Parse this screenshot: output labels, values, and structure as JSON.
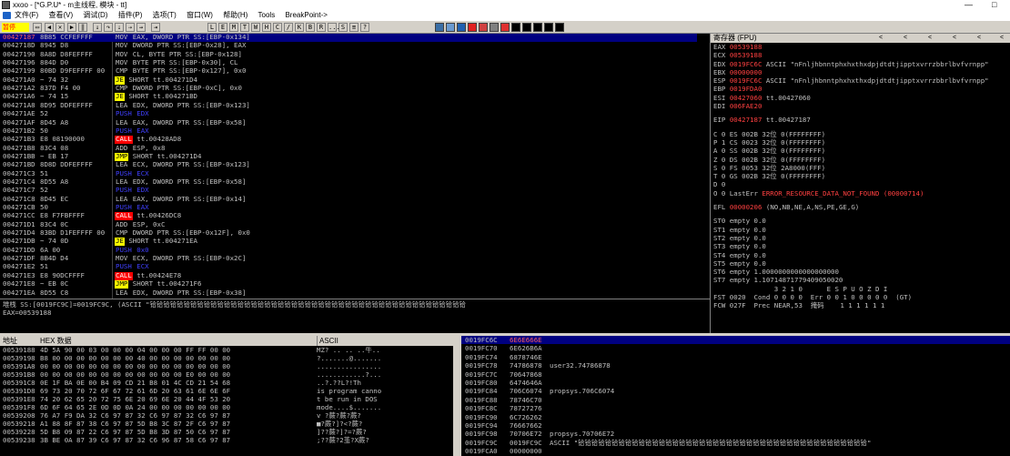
{
  "title": "xxoo - [*G.P.U* - m主线程, 模块 - tt]",
  "window_controls": [
    "—",
    "□"
  ],
  "menu": [
    "文件(F)",
    "查看(V)",
    "调试(D)",
    "插件(P)",
    "选项(T)",
    "窗口(W)",
    "帮助(H)",
    "Tools",
    "BreakPoint->"
  ],
  "status": "暂停",
  "toolbar_letters": [
    "L",
    "E",
    "M",
    "T",
    "W",
    "H",
    "C",
    "/",
    "K",
    "B",
    "R",
    "...",
    "S",
    "≡",
    "?"
  ],
  "disasm": [
    {
      "addr": "00427187",
      "hex": "8B85 CCFEFFFF",
      "asm": "MOV EAX, DWORD PTR SS:[EBP-0x134]",
      "kind": "mov",
      "comment": ""
    },
    {
      "addr": "0042718D",
      "hex": "8945 D8",
      "asm": "MOV DWORD PTR SS:[EBP-0x28], EAX",
      "kind": "mov",
      "comment": ""
    },
    {
      "addr": "00427190",
      "hex": "8A8D D8FEFFFF",
      "asm": "MOV CL, BYTE PTR SS:[EBP-0x128]",
      "kind": "mov",
      "comment": ""
    },
    {
      "addr": "00427196",
      "hex": "884D D0",
      "asm": "MOV BYTE PTR SS:[EBP-0x30], CL",
      "kind": "mov",
      "comment": ""
    },
    {
      "addr": "00427199",
      "hex": "80BD D9FEFFFF 00",
      "asm": "CMP BYTE PTR SS:[EBP-0x127], 0x0",
      "kind": "cmp",
      "comment": ""
    },
    {
      "addr": "004271A0",
      "hex": "~ 74 32",
      "asm": "JE SHORT tt.004271D4",
      "kind": "cond",
      "comment": ""
    },
    {
      "addr": "004271A2",
      "hex": "837D F4 00",
      "asm": "CMP DWORD PTR SS:[EBP-0xC], 0x0",
      "kind": "cmp",
      "comment": ""
    },
    {
      "addr": "004271A6",
      "hex": "~ 74 15",
      "asm": "JE SHORT tt.004271BD",
      "kind": "cond",
      "comment": ""
    },
    {
      "addr": "004271A8",
      "hex": "8D95 DDFEFFFF",
      "asm": "LEA EDX, DWORD PTR SS:[EBP-0x123]",
      "kind": "lea",
      "comment": ""
    },
    {
      "addr": "004271AE",
      "hex": "52",
      "asm": "PUSH EDX",
      "kind": "stack",
      "comment": ""
    },
    {
      "addr": "004271AF",
      "hex": "8D45 A8",
      "asm": "LEA EAX, DWORD PTR SS:[EBP-0x58]",
      "kind": "lea",
      "comment": ""
    },
    {
      "addr": "004271B2",
      "hex": "50",
      "asm": "PUSH EAX",
      "kind": "stack",
      "comment": ""
    },
    {
      "addr": "004271B3",
      "hex": "E8 08190000",
      "asm": "CALL tt.00428AD8",
      "kind": "call",
      "comment": ""
    },
    {
      "addr": "004271B8",
      "hex": "83C4 08",
      "asm": "ADD ESP, 0x8",
      "kind": "mov",
      "comment": ""
    },
    {
      "addr": "004271BB",
      "hex": "~ EB 17",
      "asm": "JMP SHORT tt.004271D4",
      "kind": "jmp",
      "comment": ""
    },
    {
      "addr": "004271BD",
      "hex": "8D8D DDFEFFFF",
      "asm": "LEA ECX, DWORD PTR SS:[EBP-0x123]",
      "kind": "lea",
      "comment": ""
    },
    {
      "addr": "004271C3",
      "hex": "51",
      "asm": "PUSH ECX",
      "kind": "stack",
      "comment": ""
    },
    {
      "addr": "004271C4",
      "hex": "8D55 A8",
      "asm": "LEA EDX, DWORD PTR SS:[EBP-0x58]",
      "kind": "lea",
      "comment": ""
    },
    {
      "addr": "004271C7",
      "hex": "52",
      "asm": "PUSH EDX",
      "kind": "stack",
      "comment": ""
    },
    {
      "addr": "004271C8",
      "hex": "8D45 EC",
      "asm": "LEA EAX, DWORD PTR SS:[EBP-0x14]",
      "kind": "lea",
      "comment": ""
    },
    {
      "addr": "004271CB",
      "hex": "50",
      "asm": "PUSH EAX",
      "kind": "stack",
      "comment": ""
    },
    {
      "addr": "004271CC",
      "hex": "E8 F7FBFFFF",
      "asm": "CALL tt.00426DC8",
      "kind": "call",
      "comment": ""
    },
    {
      "addr": "004271D1",
      "hex": "83C4 0C",
      "asm": "ADD ESP, 0xC",
      "kind": "mov",
      "comment": ""
    },
    {
      "addr": "004271D4",
      "hex": "83BD D1FEFFFF 00",
      "asm": "CMP DWORD PTR SS:[EBP-0x12F], 0x0",
      "kind": "cmp",
      "comment": ""
    },
    {
      "addr": "004271DB",
      "hex": "~ 74 0D",
      "asm": "JE SHORT tt.004271EA",
      "kind": "cond",
      "comment": ""
    },
    {
      "addr": "004271DD",
      "hex": "6A 00",
      "asm": "PUSH 0x0",
      "kind": "stack",
      "comment": ""
    },
    {
      "addr": "004271DF",
      "hex": "8B4D D4",
      "asm": "MOV ECX, DWORD PTR SS:[EBP-0x2C]",
      "kind": "mov",
      "comment": ""
    },
    {
      "addr": "004271E2",
      "hex": "51",
      "asm": "PUSH ECX",
      "kind": "stack",
      "comment": ""
    },
    {
      "addr": "004271E3",
      "hex": "E8 90DCFFFF",
      "asm": "CALL tt.00424E78",
      "kind": "call",
      "comment": ""
    },
    {
      "addr": "004271E8",
      "hex": "~ EB 0C",
      "asm": "JMP SHORT tt.004271F6",
      "kind": "jmp",
      "comment": ""
    },
    {
      "addr": "004271EA",
      "hex": "8D55 C8",
      "asm": "LEA EDX, DWORD PTR SS:[EBP-0x38]",
      "kind": "lea",
      "comment": ""
    }
  ],
  "info_lines": [
    "堆栈 SS:[0019FC9C]=0019FC9C, (ASCII \"铪铪铪铪铪铪铪铪铪铪铪铪铪铪铪铪铪铪铪铪铪铪铪铪铪铪铪铪铪铪铪铪铪铪铪铪铪铪铪铪铪铪铪铪铪铪铪",
    "EAX=00539188"
  ],
  "registers": {
    "header": "寄存器 (FPU)",
    "lines": [
      {
        "name": "EAX",
        "val": "00539188",
        "extra": "",
        "red": true
      },
      {
        "name": "ECX",
        "val": "00539188",
        "extra": "",
        "red": true
      },
      {
        "name": "EDX",
        "val": "0019FC6C",
        "extra": "ASCII \"nFnljhbnntphxhxthxdpjdtdtjipptxvrrzbbrlbvfvrnpp\"",
        "red": true
      },
      {
        "name": "EBX",
        "val": "00000000",
        "extra": "",
        "red": true
      },
      {
        "name": "ESP",
        "val": "0019FC6C",
        "extra": "ASCII \"nFnljhbnntphxhxthxdpjdtdtjipptxvrrzbbrlbvfvrnpp\"",
        "red": true
      },
      {
        "name": "EBP",
        "val": "0019FDA0",
        "extra": "",
        "red": true
      },
      {
        "name": "ESI",
        "val": "00427060",
        "extra": "tt.00427060",
        "red": true
      },
      {
        "name": "EDI",
        "val": "006FAE20",
        "extra": "",
        "red": true
      }
    ],
    "eip": {
      "name": "EIP",
      "val": "00427187",
      "extra": "tt.00427187"
    },
    "segs": [
      "C 0  ES 002B 32位 0(FFFFFFFF)",
      "P 1  CS 0023 32位 0(FFFFFFFF)",
      "A 0  SS 002B 32位 0(FFFFFFFF)",
      "Z 0  DS 002B 32位 0(FFFFFFFF)",
      "S 0  FS 0053 32位 2A8000(FFF)",
      "T 0  GS 002B 32位 0(FFFFFFFF)",
      "D 0"
    ],
    "lasterr_prefix": "O 0  LastErr",
    "lasterr": "ERROR_RESOURCE_DATA_NOT_FOUND (00000714)",
    "efl_label": "EFL",
    "efl_val": "00000206",
    "efl_extra": "(NO,NB,NE,A,NS,PE,GE,G)",
    "fpu": [
      "ST0 empty 0.0",
      "ST1 empty 0.0",
      "ST2 empty 0.0",
      "ST3 empty 0.0",
      "ST4 empty 0.0",
      "ST5 empty 0.0",
      "ST6 empty 1.0000000000000000000",
      "ST7 empty 1.10714871779409050020",
      "               3 2 1 0      E S P U O Z D I",
      "FST 0020  Cond 0 0 0 0  Err 0 0 1 0 0 0 0 0  (GT)",
      "FCW 027F  Prec NEAR,53  掩码    1 1 1 1 1 1"
    ]
  },
  "dump": {
    "col_addr": "地址",
    "col_hex": "HEX 数据",
    "col_ascii": "ASCII",
    "rows": [
      {
        "a": "00539188",
        "h": "4D 5A 90 00 03 00 00 00 04 00 00 00 FF FF 00 00",
        "t": "MZ?  .. ..  ..牛.."
      },
      {
        "a": "00539198",
        "h": "B8 00 00 00 00 00 00 00 40 00 00 00 00 00 00 00",
        "t": "?.......@......."
      },
      {
        "a": "005391A8",
        "h": "00 00 00 00 00 00 00 00 00 00 00 00 00 00 00 00",
        "t": "................"
      },
      {
        "a": "005391B8",
        "h": "00 00 00 00 00 00 00 00 00 00 00 00 E0 00 00 00",
        "t": "............?..."
      },
      {
        "a": "005391C8",
        "h": "0E 1F BA 0E 00 B4 09 CD 21 B8 01 4C CD 21 54 68",
        "t": "..?.??L?!Th"
      },
      {
        "a": "005391D8",
        "h": "69 73 20 70 72 6F 67 72 61 6D 20 63 61 6E 6E 6F",
        "t": "is program canno"
      },
      {
        "a": "005391E8",
        "h": "74 20 62 65 20 72 75 6E 20 69 6E 20 44 4F 53 20",
        "t": "t be run in DOS "
      },
      {
        "a": "005391F8",
        "h": "6D 6F 64 65 2E 0D 0D 0A 24 00 00 00 00 00 00 00",
        "t": "mode....$......."
      },
      {
        "a": "00539208",
        "h": "76 A7 F9 DA 32 C6 97 87 32 C6 97 87 32 C6 97 87",
        "t": "v  ?蕨?蕨?蕨?"
      },
      {
        "a": "00539218",
        "h": "A1 88 8F 87 38 C6 97 87 5D B8 3C 87 2F C6 97 87",
        "t": "  ■?蕨?]?<?蕨?"
      },
      {
        "a": "00539228",
        "h": "5D B8 09 87 22 C6 97 87 5D B8 3D 87 50 C6 97 87",
        "t": "]??蕨?]?=?蕨?"
      },
      {
        "a": "00539238",
        "h": "3B BE 0A 87 39 C6 97 87 32 C6 96 87 58 C6 97 87",
        "t": ";??蕨?2茧?X蕨?"
      }
    ]
  },
  "stack": {
    "rows": [
      {
        "a": "0019FC6C",
        "v": "6E6E666E",
        "c": "",
        "sel": true
      },
      {
        "a": "0019FC70",
        "v": "6E626B6A",
        "c": "",
        "sel": false
      },
      {
        "a": "0019FC74",
        "v": "6878746E",
        "c": "",
        "sel": false
      },
      {
        "a": "0019FC78",
        "v": "74786878",
        "c": "user32.74786878",
        "sel": false
      },
      {
        "a": "0019FC7C",
        "v": "70647868",
        "c": "",
        "sel": false
      },
      {
        "a": "0019FC80",
        "v": "6474646A",
        "c": "",
        "sel": false
      },
      {
        "a": "0019FC84",
        "v": "706C6074",
        "c": "propsys.706C6074",
        "sel": false
      },
      {
        "a": "0019FC88",
        "v": "78746C70",
        "c": "",
        "sel": false
      },
      {
        "a": "0019FC8C",
        "v": "78727276",
        "c": "",
        "sel": false
      },
      {
        "a": "0019FC90",
        "v": "6C726262",
        "c": "",
        "sel": false
      },
      {
        "a": "0019FC94",
        "v": "76667662",
        "c": "",
        "sel": false
      },
      {
        "a": "0019FC98",
        "v": "70706E72",
        "c": "propsys.70706E72",
        "sel": false
      },
      {
        "a": "0019FC9C",
        "v": "0019FC9C",
        "c": "ASCII \"铪铪铪铪铪铪铪铪铪铪铪铪铪铪铪铪铪铪铪铪铪铪铪铪铪铪铪铪铪铪铪铪铪铪铪铪铪铪铪铪铪铪铪\"",
        "sel": false
      },
      {
        "a": "0019FCA0",
        "v": "00000000",
        "c": "",
        "sel": false
      }
    ]
  }
}
